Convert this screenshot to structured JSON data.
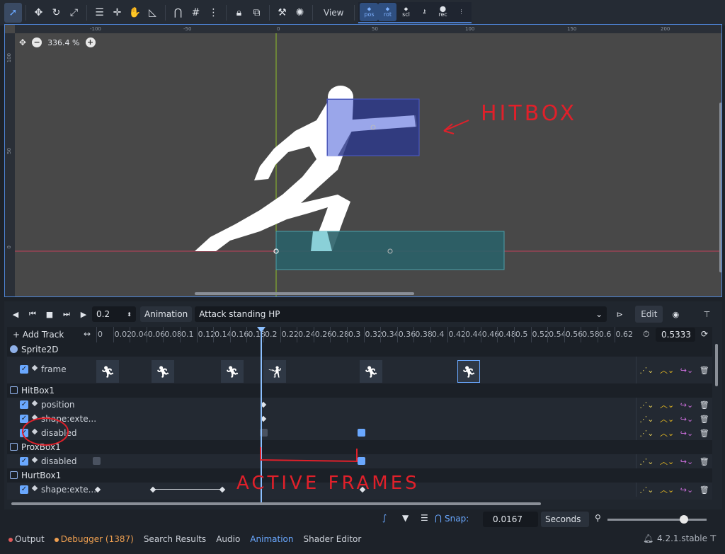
{
  "toolbar": {
    "view_label": "View",
    "group_labels": [
      "pos",
      "rot",
      "scl",
      "",
      "rec"
    ]
  },
  "viewport": {
    "zoom_label": "336.4 %",
    "ruler_top": [
      "-100",
      "-50",
      "0",
      "50",
      "100",
      "150",
      "200"
    ],
    "ruler_left": [
      "100",
      "50",
      "0"
    ]
  },
  "anim": {
    "step_value": "0.2",
    "animation_label": "Animation",
    "animation_name": "Attack standing HP",
    "edit_label": "Edit",
    "add_track_label": "Add Track",
    "length_value": "0.5333",
    "ticks": [
      "0",
      "0.02",
      "0.04",
      "0.06",
      "0.08",
      "0.1",
      "0.12",
      "0.14",
      "0.16",
      "0.18",
      "0.2",
      "0.22",
      "0.24",
      "0.26",
      "0.28",
      "0.3",
      "0.32",
      "0.34",
      "0.36",
      "0.38",
      "0.4",
      "0.42",
      "0.44",
      "0.46",
      "0.48",
      "0.5",
      "0.52",
      "0.54",
      "0.56",
      "0.58",
      "0.6",
      "0.62"
    ],
    "nodes": {
      "sprite": "Sprite2D",
      "hitbox": "HitBox1",
      "proxbox": "ProxBox1",
      "hurtbox": "HurtBox1"
    },
    "tracks": {
      "frame": "frame",
      "position": "position",
      "shape_extents": "shape:exte...",
      "disabled": "disabled",
      "prox_disabled": "disabled",
      "hurt_shape": "shape:exte..."
    },
    "snap_label": "Snap:",
    "snap_value": "0.0167",
    "snap_unit": "Seconds"
  },
  "annotations": {
    "hitbox": "HITBOX",
    "active_frames": "ACTIVE FRAMES"
  },
  "statusbar": {
    "output": "Output",
    "debugger": "Debugger (1387)",
    "search_results": "Search Results",
    "audio": "Audio",
    "animation": "Animation",
    "shader_editor": "Shader Editor",
    "version": "4.2.1.stable"
  },
  "colors": {
    "accent": "#6aa8ff",
    "hitbox_fill": "#2e3a8a",
    "hurtbox_fill": "#2a6068",
    "annotation": "#e0202a"
  }
}
